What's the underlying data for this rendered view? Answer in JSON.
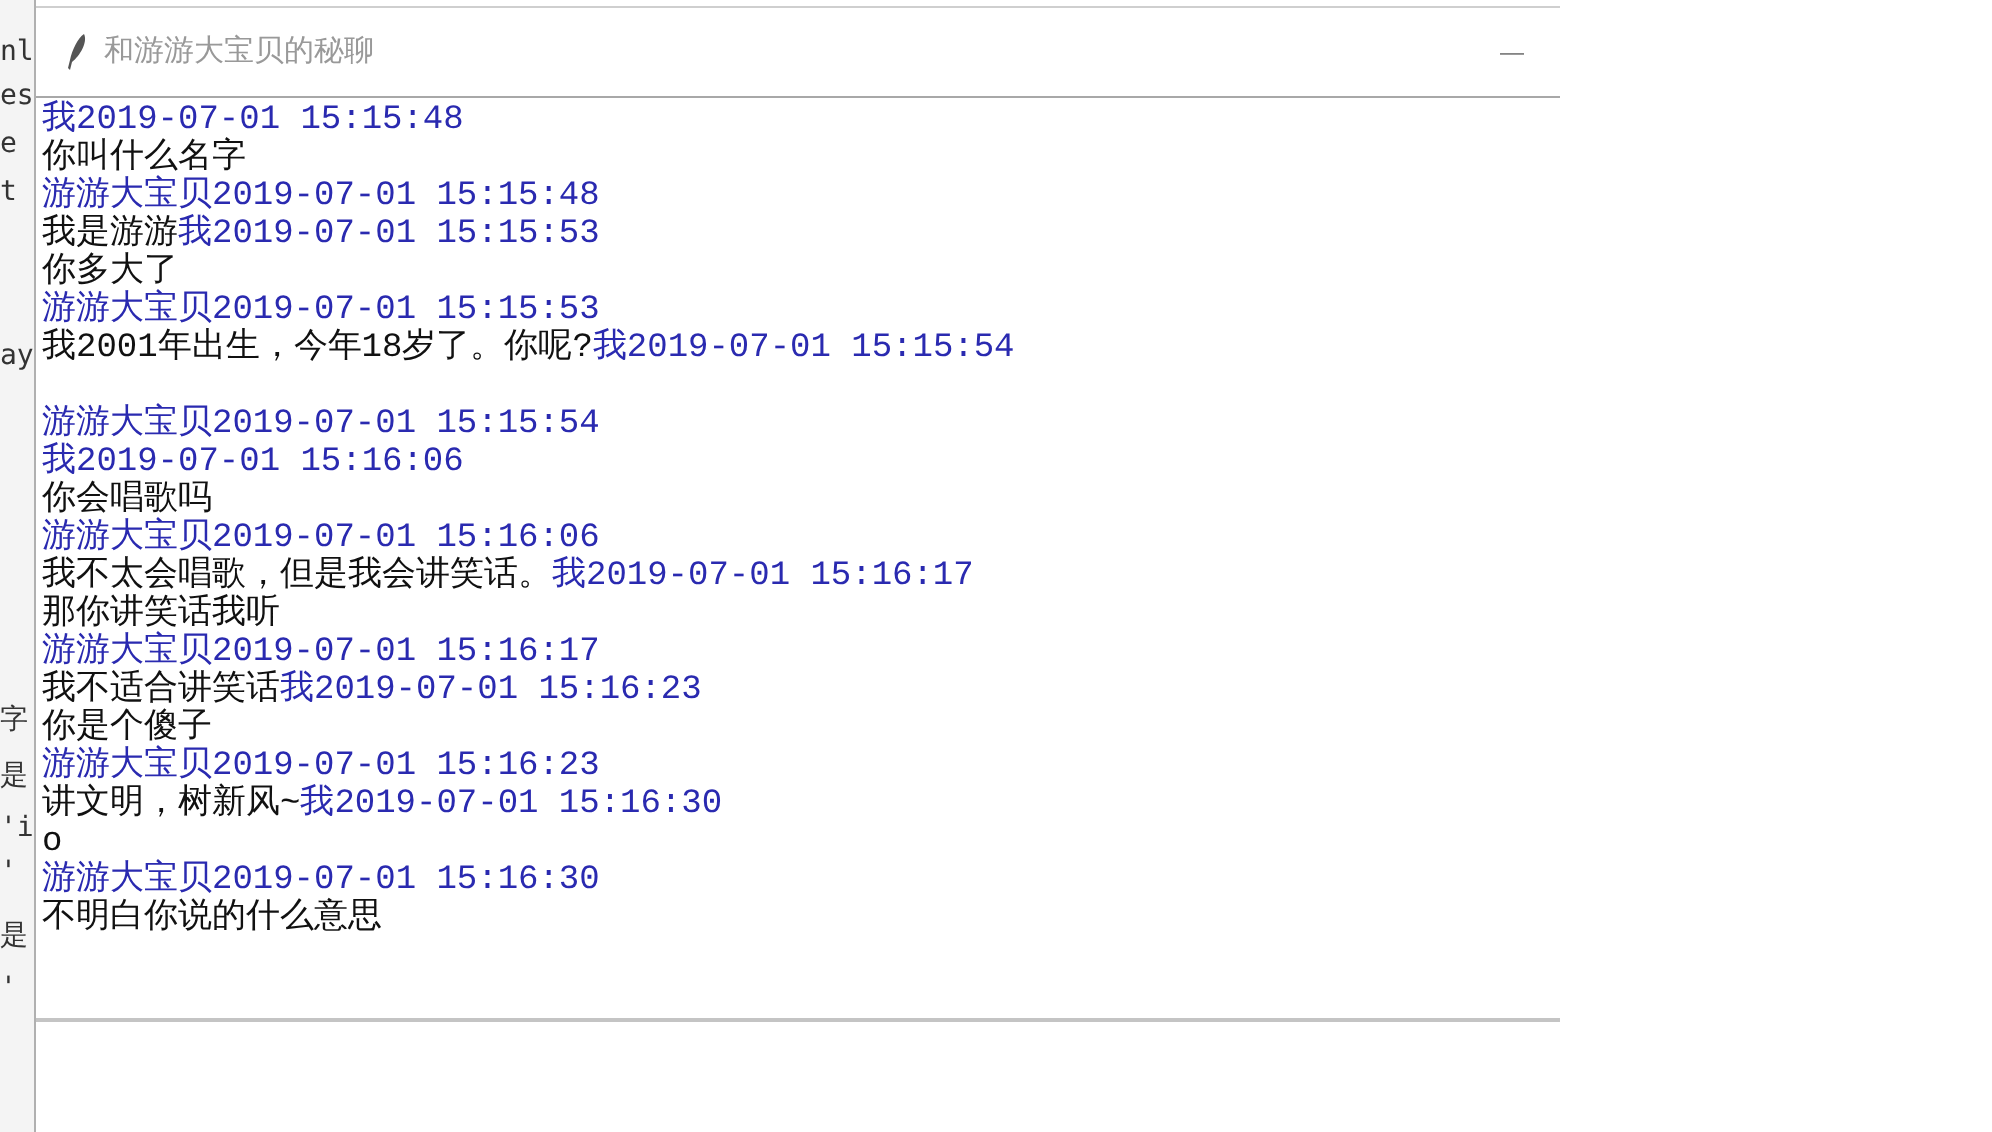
{
  "background_window": {
    "fragments": [
      "nl",
      "es",
      "e",
      "t",
      "ay",
      "字",
      "是",
      "'i",
      "'",
      "是",
      "'"
    ]
  },
  "window": {
    "title": "和游游大宝贝的秘聊",
    "minimize": "—"
  },
  "chat_log": [
    {
      "segments": [
        {
          "kind": "header",
          "text": "我2019-07-01 15:15:48"
        }
      ]
    },
    {
      "segments": [
        {
          "kind": "message",
          "text": "你叫什么名字"
        }
      ]
    },
    {
      "segments": [
        {
          "kind": "header",
          "text": "游游大宝贝2019-07-01 15:15:48"
        }
      ]
    },
    {
      "segments": [
        {
          "kind": "message",
          "text": "我是游游"
        },
        {
          "kind": "header",
          "text": "我2019-07-01 15:15:53"
        }
      ]
    },
    {
      "segments": [
        {
          "kind": "message",
          "text": "你多大了"
        }
      ]
    },
    {
      "segments": [
        {
          "kind": "header",
          "text": "游游大宝贝2019-07-01 15:15:53"
        }
      ]
    },
    {
      "segments": [
        {
          "kind": "message",
          "text": "我2001年出生，今年18岁了。你呢?"
        },
        {
          "kind": "header",
          "text": "我2019-07-01 15:15:54"
        }
      ]
    },
    {
      "blank_before": true,
      "segments": [
        {
          "kind": "header",
          "text": "游游大宝贝2019-07-01 15:15:54"
        }
      ]
    },
    {
      "segments": [
        {
          "kind": "header",
          "text": "我2019-07-01 15:16:06"
        }
      ]
    },
    {
      "segments": [
        {
          "kind": "message",
          "text": "你会唱歌吗"
        }
      ]
    },
    {
      "segments": [
        {
          "kind": "header",
          "text": "游游大宝贝2019-07-01 15:16:06"
        }
      ]
    },
    {
      "segments": [
        {
          "kind": "message",
          "text": "我不太会唱歌，但是我会讲笑话。"
        },
        {
          "kind": "header",
          "text": "我2019-07-01 15:16:17"
        }
      ]
    },
    {
      "segments": [
        {
          "kind": "message",
          "text": "那你讲笑话我听"
        }
      ]
    },
    {
      "segments": [
        {
          "kind": "header",
          "text": "游游大宝贝2019-07-01 15:16:17"
        }
      ]
    },
    {
      "segments": [
        {
          "kind": "message",
          "text": "我不适合讲笑话"
        },
        {
          "kind": "header",
          "text": "我2019-07-01 15:16:23"
        }
      ]
    },
    {
      "segments": [
        {
          "kind": "message",
          "text": "你是个傻子"
        }
      ]
    },
    {
      "segments": [
        {
          "kind": "header",
          "text": "游游大宝贝2019-07-01 15:16:23"
        }
      ]
    },
    {
      "segments": [
        {
          "kind": "message",
          "text": "讲文明，树新风~"
        },
        {
          "kind": "header",
          "text": "我2019-07-01 15:16:30"
        }
      ]
    },
    {
      "segments": [
        {
          "kind": "message",
          "text": "o"
        }
      ]
    },
    {
      "segments": [
        {
          "kind": "header",
          "text": "游游大宝贝2019-07-01 15:16:30"
        }
      ]
    },
    {
      "segments": [
        {
          "kind": "message",
          "text": "不明白你说的什么意思"
        }
      ]
    }
  ]
}
